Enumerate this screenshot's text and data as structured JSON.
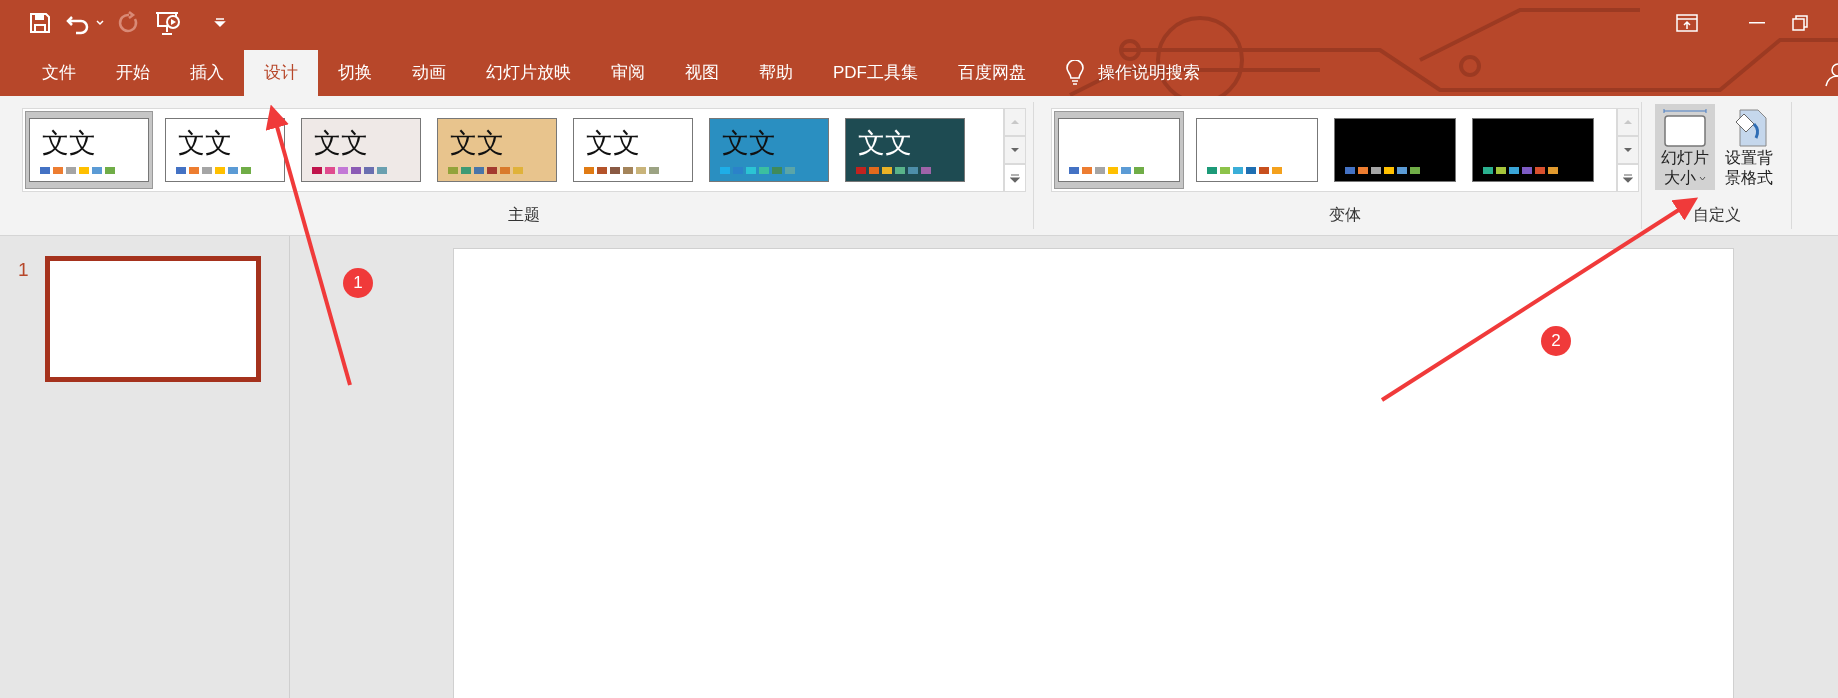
{
  "tabs": [
    {
      "label": "文件",
      "selected": false
    },
    {
      "label": "开始",
      "selected": false
    },
    {
      "label": "插入",
      "selected": false
    },
    {
      "label": "设计",
      "selected": true
    },
    {
      "label": "切换",
      "selected": false
    },
    {
      "label": "动画",
      "selected": false
    },
    {
      "label": "幻灯片放映",
      "selected": false
    },
    {
      "label": "审阅",
      "selected": false
    },
    {
      "label": "视图",
      "selected": false
    },
    {
      "label": "帮助",
      "selected": false
    },
    {
      "label": "PDF工具集",
      "selected": false
    },
    {
      "label": "百度网盘",
      "selected": false
    }
  ],
  "tell_me": "操作说明搜索",
  "themes": {
    "label": "主题",
    "items": [
      {
        "sample": "文文",
        "dark": false,
        "selected": true,
        "background": {
          "color": "#ffffff"
        },
        "swatches": [
          {
            "color": "#4472c4"
          },
          {
            "color": "#ed7d31"
          },
          {
            "color": "#a5a5a5"
          },
          {
            "color": "#ffc000"
          },
          {
            "color": "#5b9bd5"
          },
          {
            "color": "#70ad47"
          }
        ]
      },
      {
        "sample": "文文",
        "dark": false,
        "selected": false,
        "background": {
          "color": "#ffffff"
        },
        "swatches": [
          {
            "color": "#4472c4"
          },
          {
            "color": "#ed7d31"
          },
          {
            "color": "#a5a5a5"
          },
          {
            "color": "#ffc000"
          },
          {
            "color": "#5b9bd5"
          },
          {
            "color": "#70ad47"
          }
        ]
      },
      {
        "sample": "文文",
        "dark": false,
        "selected": false,
        "background": {
          "color": "#efe9e7"
        },
        "swatches": [
          {
            "color": "#c0144c"
          },
          {
            "color": "#e04b8e"
          },
          {
            "color": "#c378d6"
          },
          {
            "color": "#8b5bb5"
          },
          {
            "color": "#6a6fb0"
          },
          {
            "color": "#6aa0b0"
          }
        ]
      },
      {
        "sample": "文文",
        "dark": false,
        "selected": false,
        "background": {
          "color": "#e8c48d"
        },
        "swatches": [
          {
            "color": "#93a33a"
          },
          {
            "color": "#3e9a74"
          },
          {
            "color": "#4975a8"
          },
          {
            "color": "#a33a2f"
          },
          {
            "color": "#d97a2b"
          },
          {
            "color": "#e0b23a"
          }
        ]
      },
      {
        "sample": "文文",
        "dark": false,
        "selected": false,
        "background": {
          "color": "#ffffff"
        },
        "swatches": [
          {
            "color": "#e07b14"
          },
          {
            "color": "#b4532a"
          },
          {
            "color": "#8a5a44"
          },
          {
            "color": "#a4845a"
          },
          {
            "color": "#c9b47a"
          },
          {
            "color": "#9ca383"
          }
        ]
      },
      {
        "sample": "文文",
        "dark": false,
        "selected": false,
        "background": {
          "color": "#2a8fc1"
        },
        "swatches": [
          {
            "color": "#1eaee8"
          },
          {
            "color": "#2b82c9"
          },
          {
            "color": "#2bc4d4"
          },
          {
            "color": "#3bbfa0"
          },
          {
            "color": "#3f8a5a"
          },
          {
            "color": "#5aa5a8"
          }
        ]
      },
      {
        "sample": "文文",
        "dark": true,
        "selected": false,
        "background": {
          "color": "#1e4b52"
        },
        "swatches": [
          {
            "color": "#c2231f"
          },
          {
            "color": "#e16a1d"
          },
          {
            "color": "#e8b226"
          },
          {
            "color": "#58b38a"
          },
          {
            "color": "#4d8ea9"
          },
          {
            "color": "#9e63a8"
          }
        ]
      }
    ]
  },
  "variants": {
    "label": "变体",
    "items": [
      {
        "selected": true,
        "background": {
          "color": "#ffffff"
        },
        "swatches": [
          {
            "color": "#4472c4"
          },
          {
            "color": "#ed7d31"
          },
          {
            "color": "#a5a5a5"
          },
          {
            "color": "#ffc000"
          },
          {
            "color": "#5b9bd5"
          },
          {
            "color": "#70ad47"
          }
        ]
      },
      {
        "selected": false,
        "background": {
          "color": "#ffffff"
        },
        "swatches": [
          {
            "color": "#1c9a78"
          },
          {
            "color": "#8dc34a"
          },
          {
            "color": "#3aaed8"
          },
          {
            "color": "#1f6fb2"
          },
          {
            "color": "#c8501e"
          },
          {
            "color": "#f4a11d"
          }
        ]
      },
      {
        "selected": false,
        "background": {
          "color": "#000000"
        },
        "swatches": [
          {
            "color": "#4472c4"
          },
          {
            "color": "#ed7d31"
          },
          {
            "color": "#a5a5a5"
          },
          {
            "color": "#ffc000"
          },
          {
            "color": "#5b9bd5"
          },
          {
            "color": "#70ad47"
          }
        ]
      },
      {
        "selected": false,
        "background": {
          "color": "#000000"
        },
        "swatches": [
          {
            "color": "#2bb18f"
          },
          {
            "color": "#a5c43b"
          },
          {
            "color": "#3aa5d8"
          },
          {
            "color": "#7d5bc4"
          },
          {
            "color": "#d8502e"
          },
          {
            "color": "#e19a2e"
          }
        ]
      }
    ]
  },
  "customize": {
    "label": "自定义",
    "buttons": [
      {
        "kind": "slide_size",
        "lines": [
          "幻灯片",
          "大小"
        ],
        "selected": true
      },
      {
        "kind": "background",
        "lines": [
          "设置背",
          "景格式"
        ],
        "selected": false
      }
    ]
  },
  "slides": [
    {
      "number": "1",
      "selected": true
    }
  ],
  "annotations": [
    {
      "label": "1"
    },
    {
      "label": "2"
    }
  ]
}
